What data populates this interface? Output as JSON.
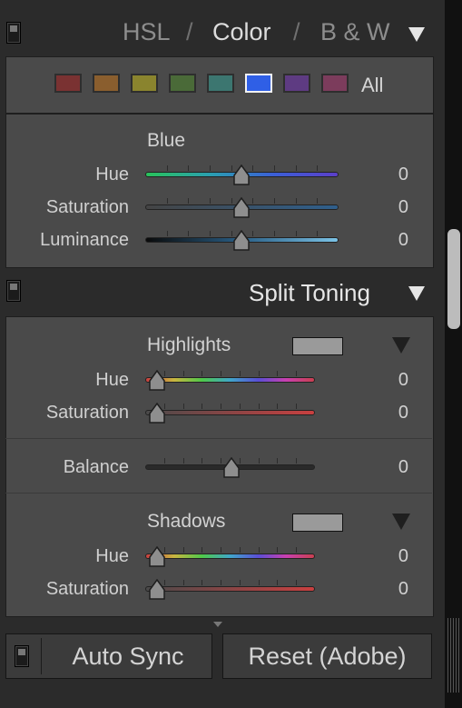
{
  "hsl_header": {
    "tabs": [
      "HSL",
      "Color",
      "B & W"
    ],
    "separators": [
      "/",
      "/"
    ],
    "active_tab": "Color"
  },
  "color_swatches": {
    "items": [
      {
        "name": "Red",
        "color": "#7a3232"
      },
      {
        "name": "Orange",
        "color": "#8a5e2e"
      },
      {
        "name": "Yellow",
        "color": "#8a842e"
      },
      {
        "name": "Green",
        "color": "#4a6a38"
      },
      {
        "name": "Aqua",
        "color": "#3c7670"
      },
      {
        "name": "Blue",
        "color": "#2f5fe6"
      },
      {
        "name": "Purple",
        "color": "#5e3b82"
      },
      {
        "name": "Magenta",
        "color": "#7c3c5c"
      }
    ],
    "selected": "Blue",
    "all_label": "All"
  },
  "color_panel": {
    "group_title": "Blue",
    "sliders": [
      {
        "label": "Hue",
        "value": "0",
        "level": 0.5
      },
      {
        "label": "Saturation",
        "value": "0",
        "level": 0.5
      },
      {
        "label": "Luminance",
        "value": "0",
        "level": 0.5
      }
    ]
  },
  "split_toning": {
    "title": "Split Toning",
    "highlights": {
      "title": "Highlights",
      "sliders": [
        {
          "label": "Hue",
          "value": "0",
          "level": 0.0
        },
        {
          "label": "Saturation",
          "value": "0",
          "level": 0.0
        }
      ]
    },
    "balance": {
      "label": "Balance",
      "value": "0",
      "level": 0.5
    },
    "shadows": {
      "title": "Shadows",
      "sliders": [
        {
          "label": "Hue",
          "value": "0",
          "level": 0.0
        },
        {
          "label": "Saturation",
          "value": "0",
          "level": 0.0
        }
      ]
    }
  },
  "footer": {
    "auto_sync_label": "Auto Sync",
    "reset_label": "Reset (Adobe)"
  }
}
